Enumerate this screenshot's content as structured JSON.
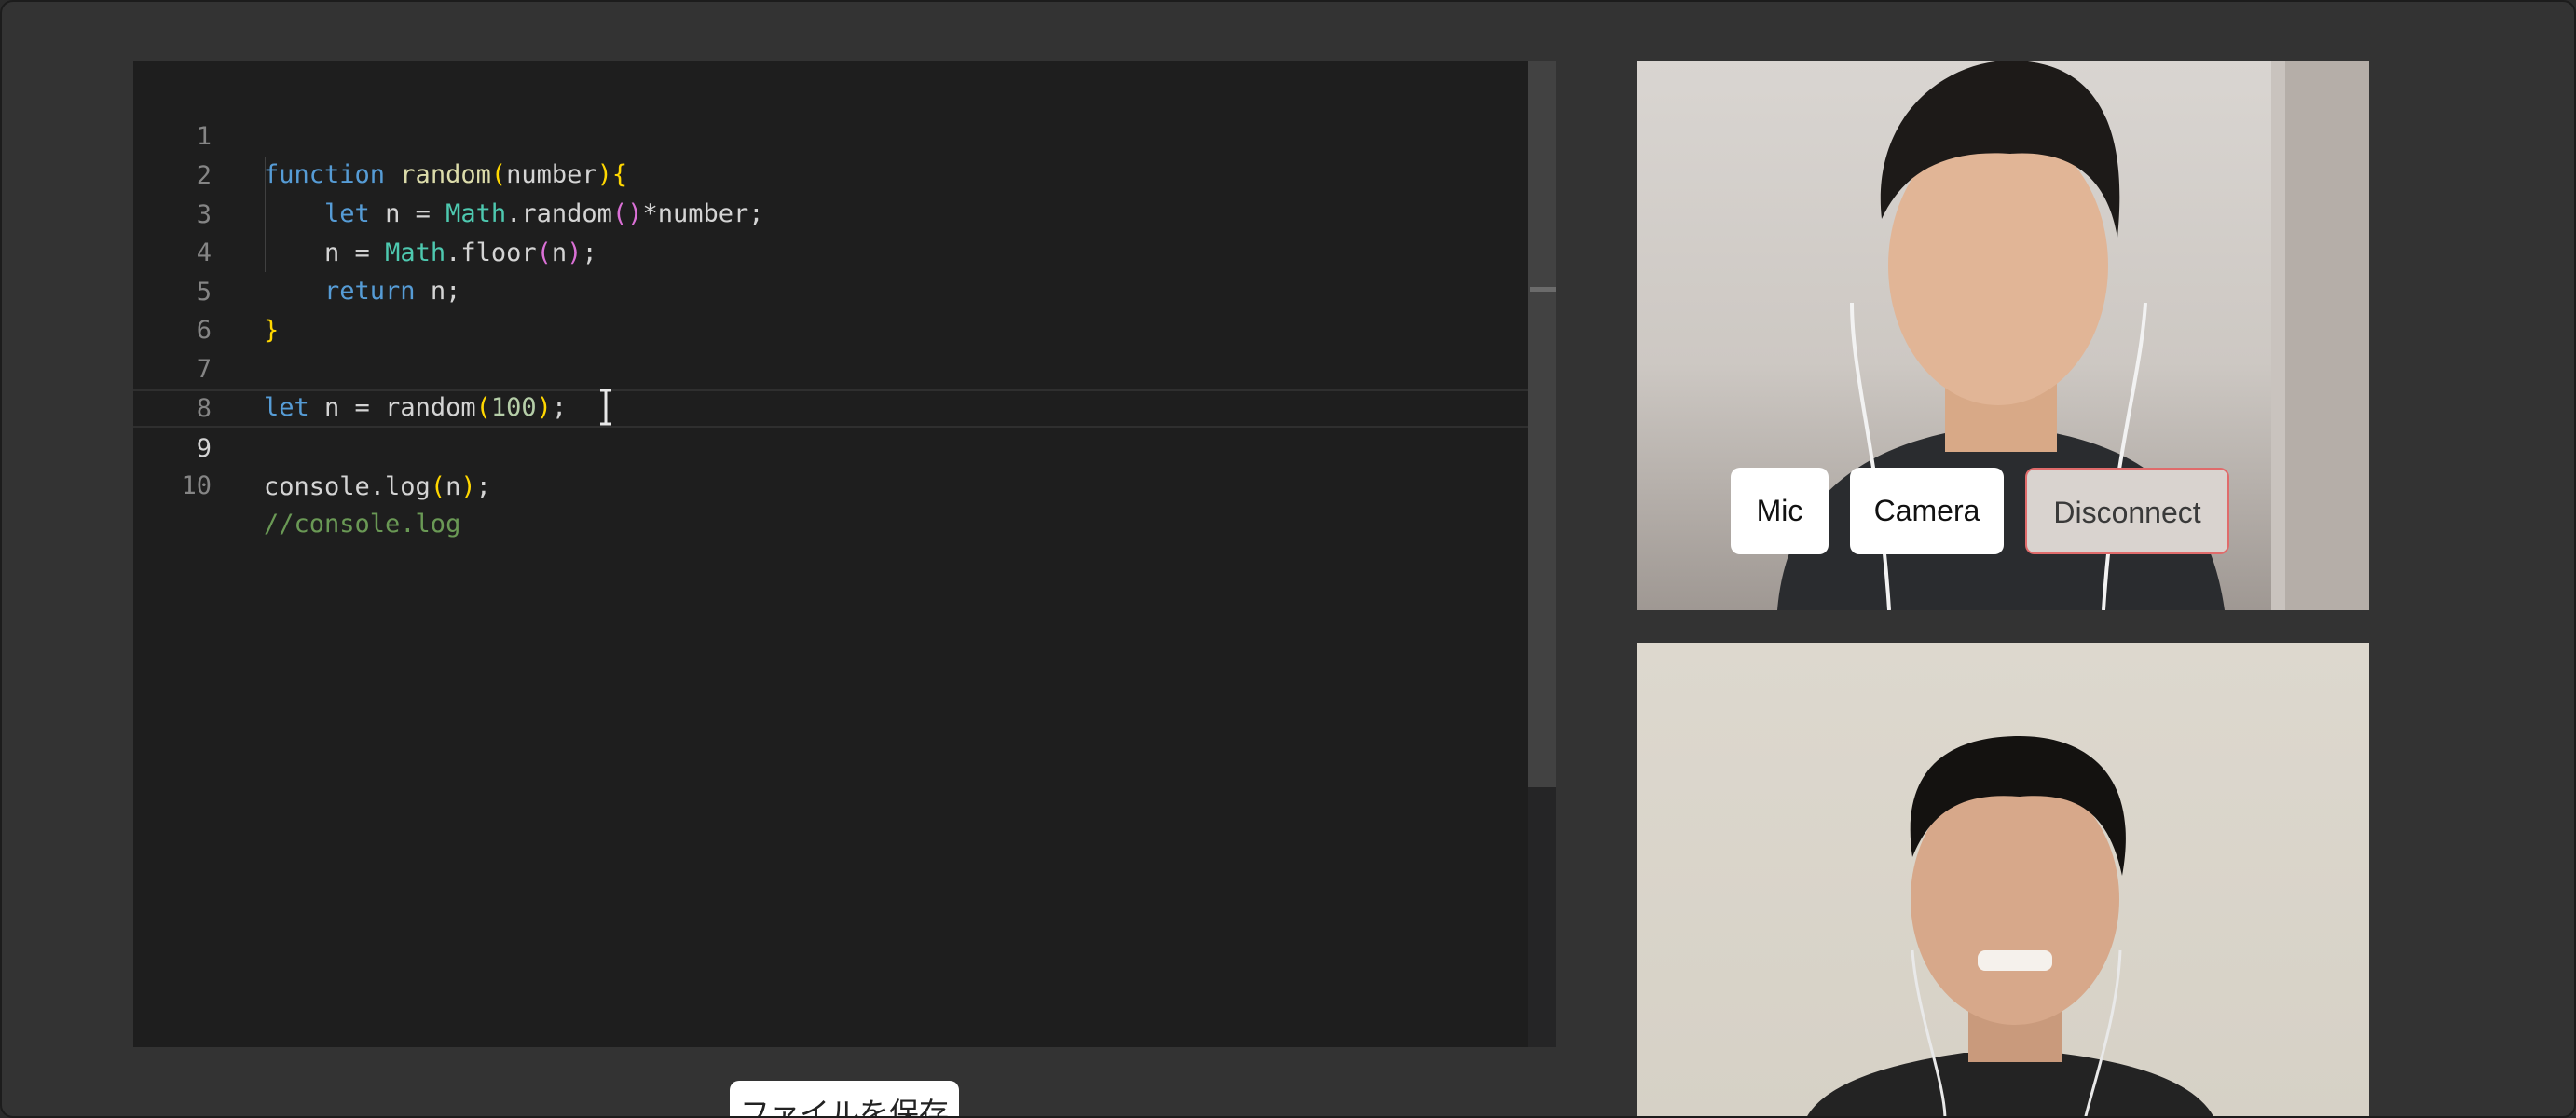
{
  "editor": {
    "lines": [
      {
        "number": "1"
      },
      {
        "number": "2"
      },
      {
        "number": "3"
      },
      {
        "number": "4"
      },
      {
        "number": "5"
      },
      {
        "number": "6"
      },
      {
        "number": "7"
      },
      {
        "number": "8"
      },
      {
        "number": "9"
      },
      {
        "number": "10"
      }
    ],
    "active_line": "9",
    "tokens": {
      "l1_kw": "function",
      "l1_fn": " random",
      "l1_open": "(",
      "l1_param": "number",
      "l1_close": ")",
      "l1_brace": "{",
      "l2_indent": "    ",
      "l2_kw": "let",
      "l2_rest": " n = ",
      "l2_cls": "Math",
      "l2_dot": ".random",
      "l2_paren": "()",
      "l2_tail": "*number;",
      "l3_indent": "    ",
      "l3_pre": "n = ",
      "l3_cls": "Math",
      "l3_dot": ".floor",
      "l3_open": "(",
      "l3_arg": "n",
      "l3_close": ")",
      "l3_semi": ";",
      "l4_indent": "    ",
      "l4_kw": "return",
      "l4_rest": " n;",
      "l5_brace": "}",
      "l7_kw": "let",
      "l7_rest": " n = random",
      "l7_open": "(",
      "l7_num": "100",
      "l7_close": ")",
      "l7_semi": ";",
      "l9_pre": "console.log",
      "l9_open": "(",
      "l9_arg": "n",
      "l9_close": ")",
      "l9_semi": ";",
      "l10_comment": "//console.log"
    }
  },
  "actions": {
    "save_label": "ファイルを保存"
  },
  "call": {
    "mic_label": "Mic",
    "camera_label": "Camera",
    "disconnect_label": "Disconnect"
  },
  "colors": {
    "editor_bg": "#1e1e1e",
    "keyword": "#569cd6",
    "class_name": "#4ec9b0",
    "number": "#b5cea8",
    "comment": "#6a9955",
    "bracket_gold": "#ffd700",
    "bracket_purple": "#da70d6",
    "disconnect_border": "#e06b6b"
  }
}
